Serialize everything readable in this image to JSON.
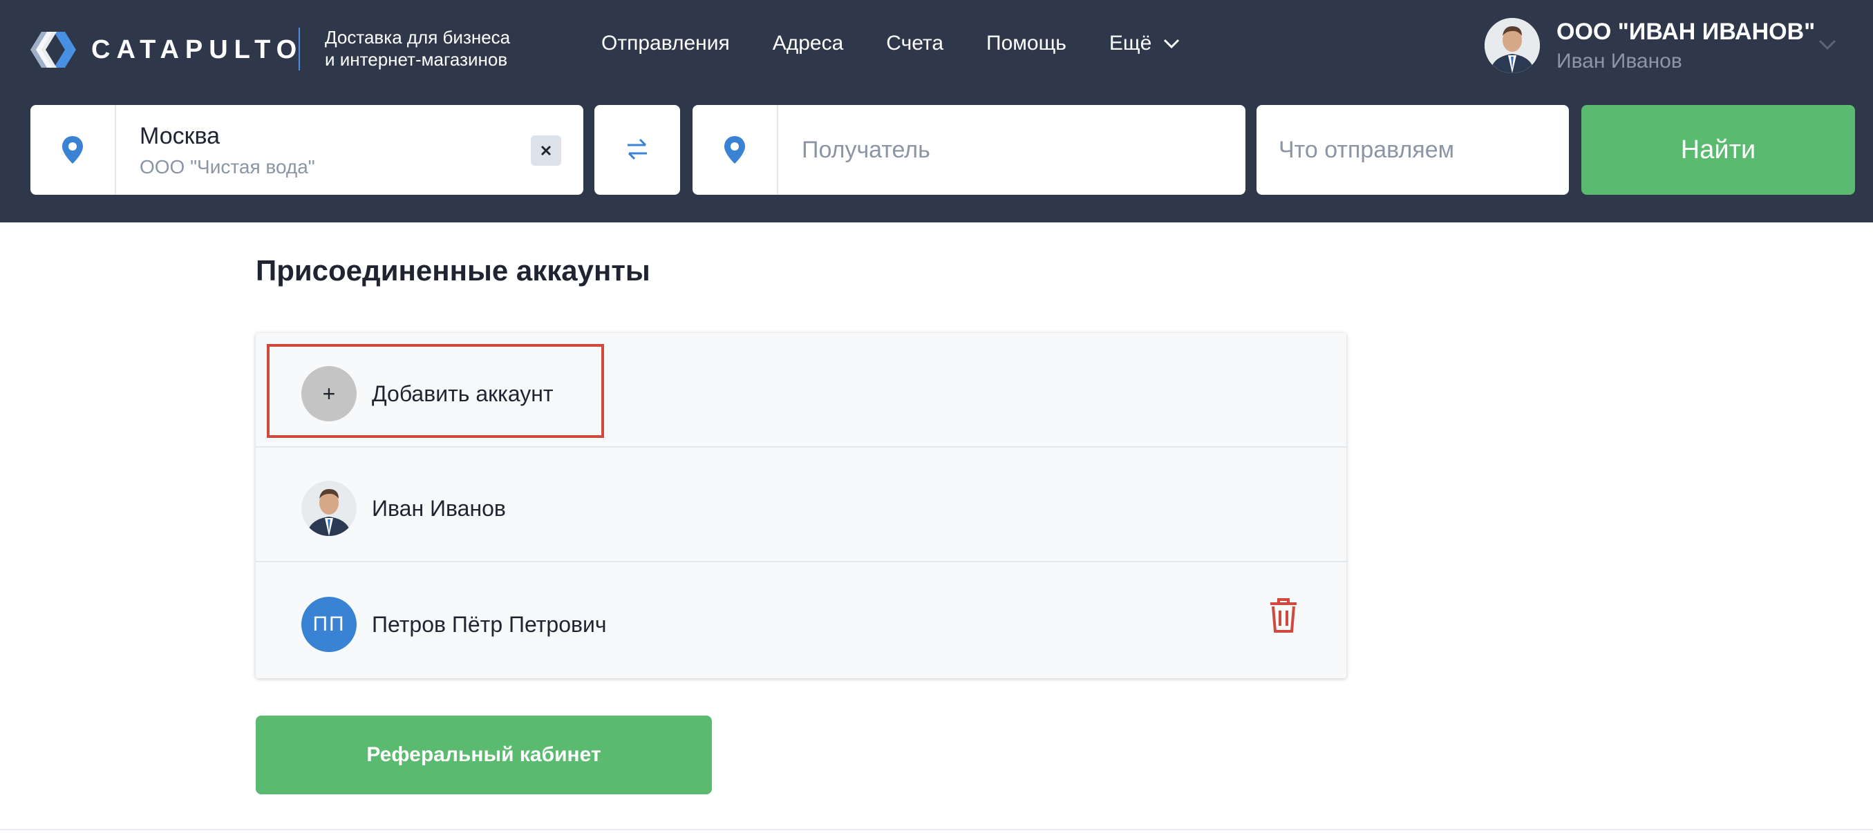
{
  "colors": {
    "header_bg": "#2f384a",
    "accent_blue": "#3a83d4",
    "primary_green": "#5aba6f",
    "danger_red": "#d0493f"
  },
  "header": {
    "brand": "CATAPULTO",
    "tagline_line1": "Доставка для бизнеса",
    "tagline_line2": "и интернет-магазинов",
    "nav": [
      {
        "label": "Отправления"
      },
      {
        "label": "Адреса"
      },
      {
        "label": "Счета"
      },
      {
        "label": "Помощь"
      },
      {
        "label": "Ещё",
        "icon": "chevron-down-icon"
      }
    ],
    "profile": {
      "org": "ООО \"ИВАН ИВАНОВ\"",
      "name": "Иван Иванов"
    }
  },
  "search": {
    "from": {
      "city": "Москва",
      "org": "ООО \"Чистая вода\"",
      "icon": "location-pin-icon"
    },
    "swap_icon": "swap-arrows-icon",
    "to": {
      "placeholder": "Получатель",
      "icon": "location-pin-icon"
    },
    "what": {
      "placeholder": "Что отправляем"
    },
    "find_label": "Найти"
  },
  "main": {
    "title": "Присоединенные аккаунты",
    "add_account_label": "Добавить аккаунт",
    "add_icon_glyph": "+",
    "accounts": [
      {
        "name": "Иван Иванов",
        "avatar": "photo"
      },
      {
        "name": "Петров Пётр Петрович",
        "initials": "ПП",
        "deletable": true
      }
    ],
    "referral_label": "Реферальный кабинет"
  }
}
